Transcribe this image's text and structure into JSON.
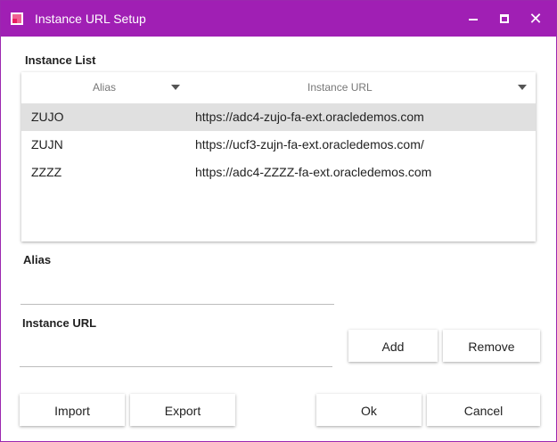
{
  "window": {
    "title": "Instance URL Setup",
    "accent": "#a01fb4"
  },
  "titlebar": {
    "minimize": "minimize-icon",
    "maximize": "maximize-icon",
    "close": "close-icon",
    "close_glyph": "✕"
  },
  "instance_list": {
    "label": "Instance List",
    "columns": [
      "Alias",
      "Instance URL"
    ],
    "rows": [
      {
        "alias": "ZUJO",
        "url": "https://adc4-zujo-fa-ext.oracledemos.com",
        "selected": true
      },
      {
        "alias": "ZUJN",
        "url": "https://ucf3-zujn-fa-ext.oracledemos.com/",
        "selected": false
      },
      {
        "alias": "ZZZZ",
        "url": "https://adc4-ZZZZ-fa-ext.oracledemos.com",
        "selected": false
      }
    ]
  },
  "form": {
    "alias_label": "Alias",
    "alias_value": "",
    "url_label": "Instance URL",
    "url_value": ""
  },
  "buttons": {
    "add": "Add",
    "remove": "Remove",
    "import": "Import",
    "export": "Export",
    "ok": "Ok",
    "cancel": "Cancel"
  }
}
